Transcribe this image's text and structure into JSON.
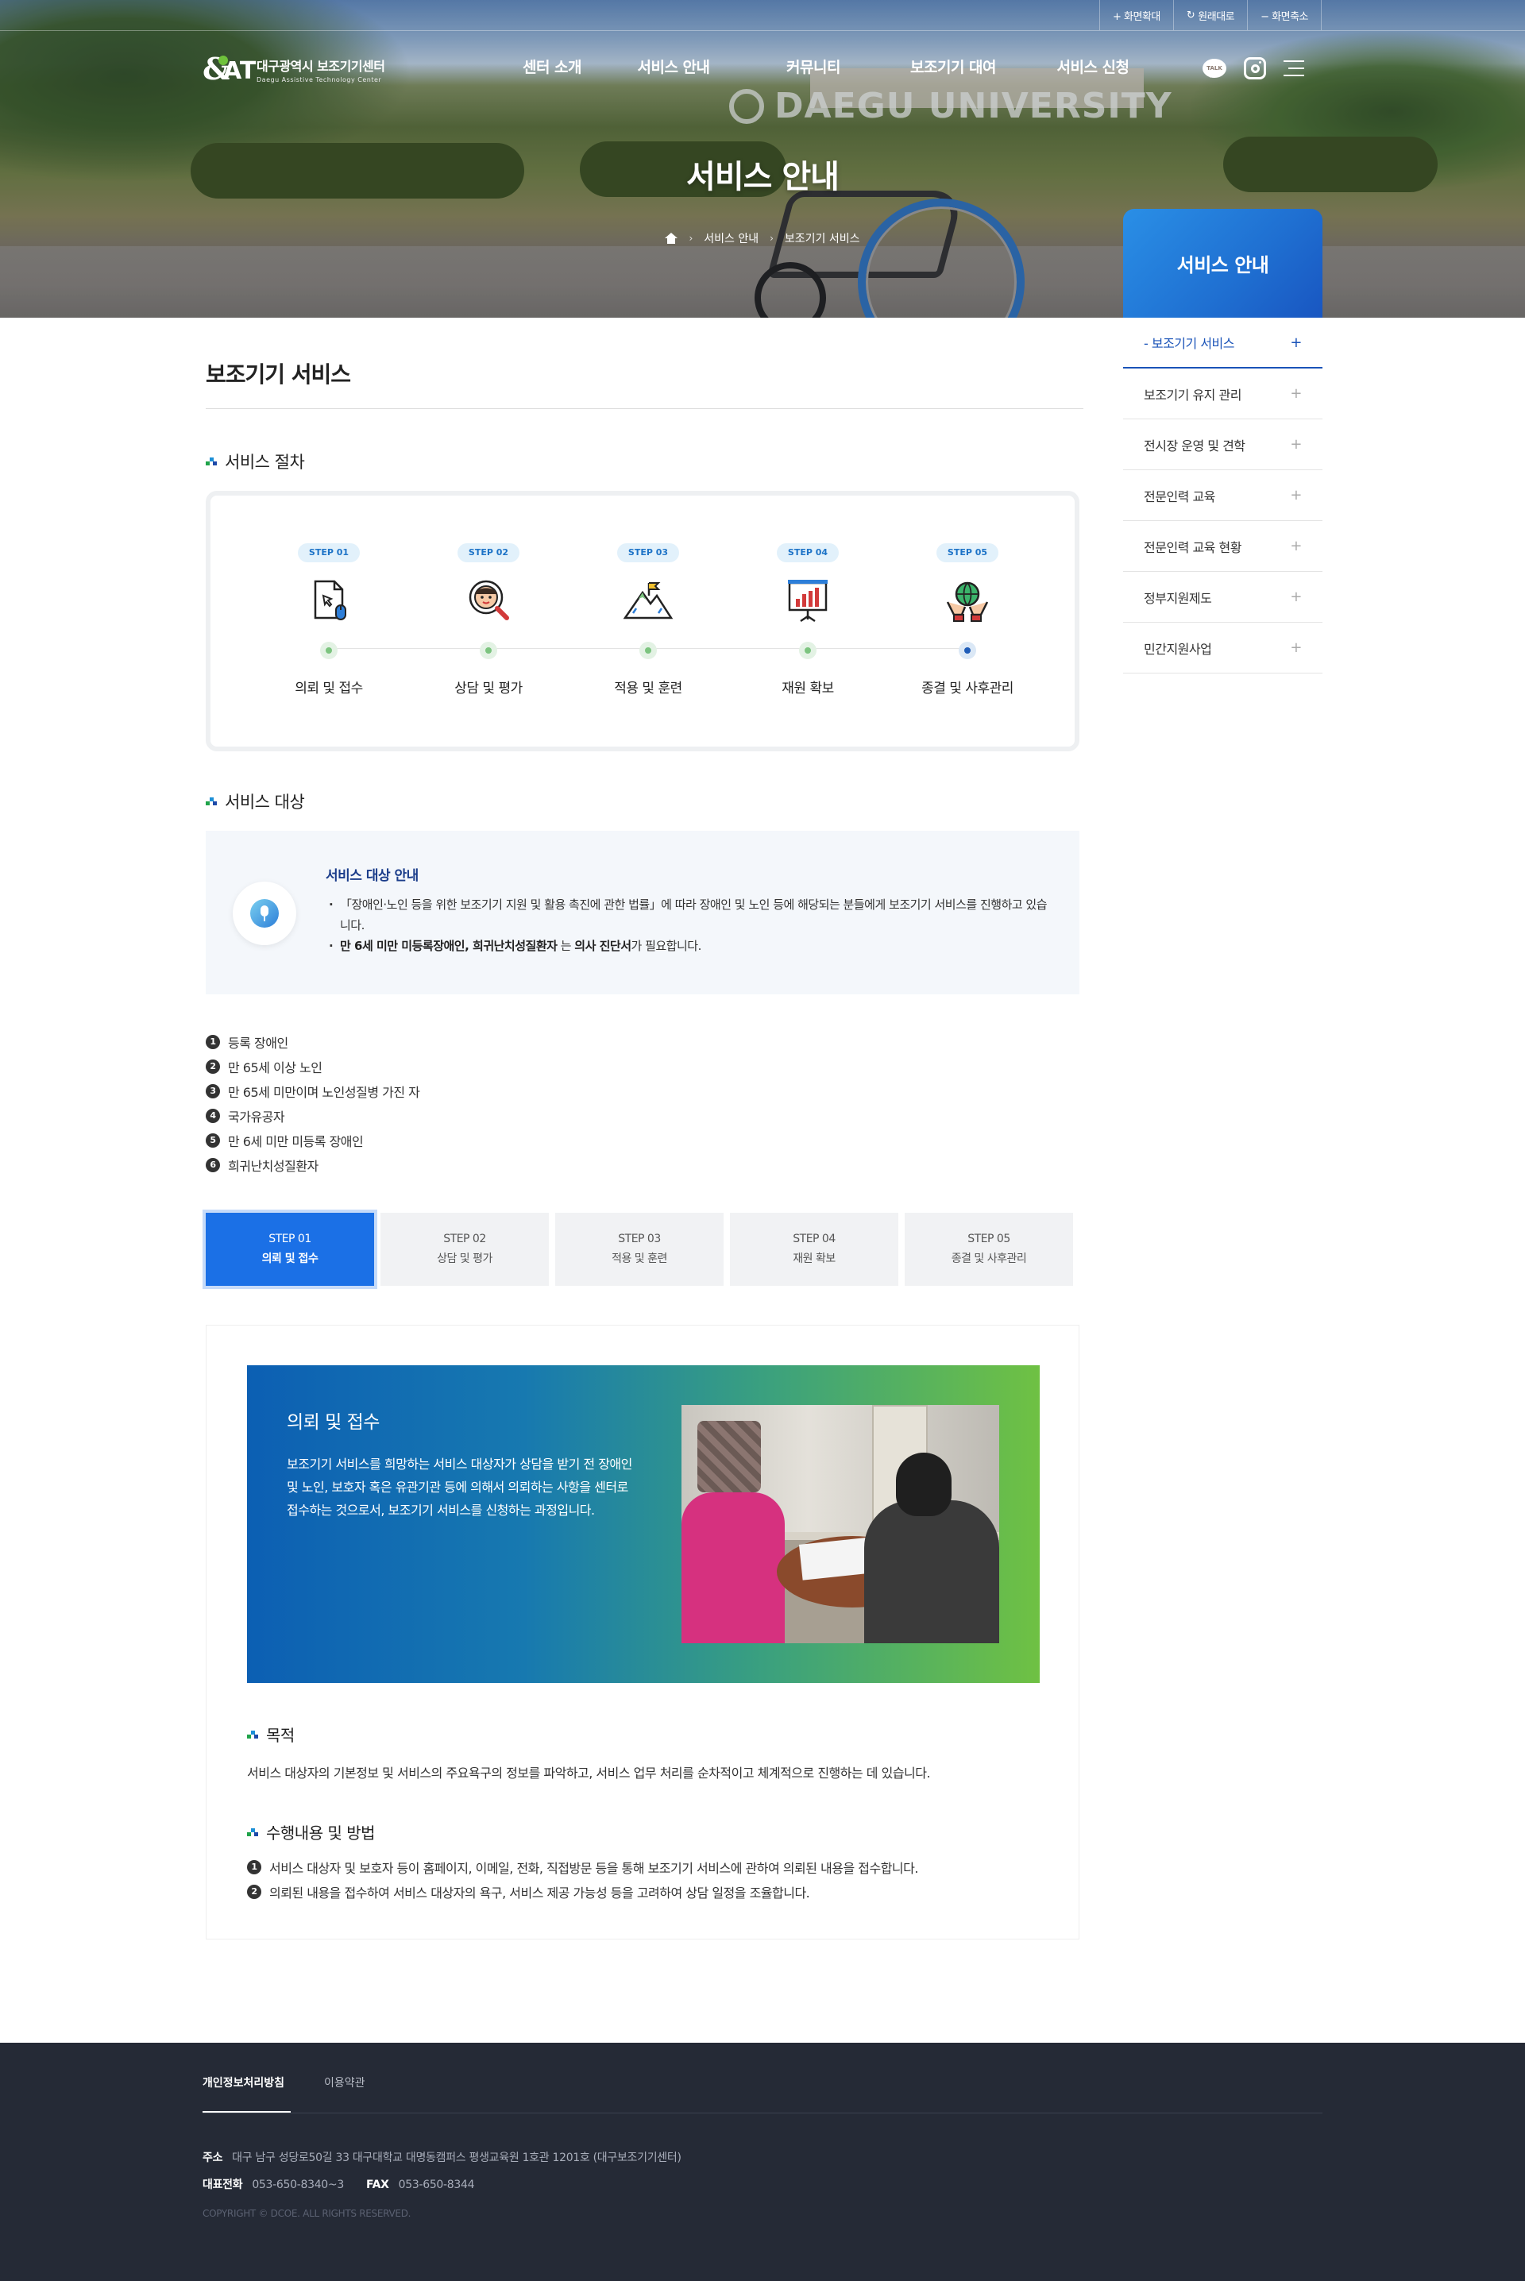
{
  "util": [
    "+ 화면확대",
    "원래대로",
    "− 화면축소"
  ],
  "logo": {
    "kr": "대구광역시 보조기기센터",
    "en": "Daegu Assistive Technology Center"
  },
  "gnb": [
    "센터 소개",
    "서비스 안내",
    "커뮤니티",
    "보조기기 대여",
    "서비스 신청"
  ],
  "header_icons": {
    "talk": "TALK"
  },
  "hero": {
    "sign": "DAEGU UNIVERSITY",
    "title": "서비스 안내",
    "crumb": [
      "서비스 안내",
      "보조기기 서비스"
    ]
  },
  "sidebar": {
    "title": "서비스 안내",
    "items": [
      {
        "label": "-  보조기기 서비스",
        "active": true
      },
      {
        "label": "보조기기 유지 관리"
      },
      {
        "label": "전시장 운영 및 견학"
      },
      {
        "label": "전문인력 교육"
      },
      {
        "label": "전문인력 교육 현황"
      },
      {
        "label": "정부지원제도"
      },
      {
        "label": "민간지원사업"
      }
    ],
    "plus": "+"
  },
  "page_title": "보조기기 서비스",
  "process": {
    "heading": "서비스 절차",
    "steps": [
      {
        "badge": "STEP 01",
        "label": "의뢰 및 접수",
        "icon": "document-mouse-icon"
      },
      {
        "badge": "STEP 02",
        "label": "상담 및 평가",
        "icon": "consult-magnifier-icon"
      },
      {
        "badge": "STEP 03",
        "label": "적용 및 훈련",
        "icon": "mountain-flag-icon"
      },
      {
        "badge": "STEP 04",
        "label": "재원 확보",
        "icon": "presentation-chart-icon"
      },
      {
        "badge": "STEP 05",
        "label": "종결 및 사후관리",
        "icon": "hands-globe-icon"
      }
    ]
  },
  "target": {
    "heading": "서비스 대상",
    "box_title": "서비스 대상 안내",
    "line1": "「장애인·노인 등을 위한 보조기기 지원 및 활용 촉진에 관한 법률」에 따라 장애인 및 노인 등에 해당되는 분들에게 보조기기 서비스를 진행하고 있습니다.",
    "line2_bold": "만 6세 미만 미등록장애인, 희귀난치성질환자",
    "line2_mid": " 는 ",
    "line2_bold2": "의사 진단서",
    "line2_end": "가 필요합니다.",
    "list": [
      "등록 장애인",
      "만 65세 이상 노인",
      "만 65세 미만이며 노인성질병 가진 자",
      "국가유공자",
      "만 6세 미만 미등록 장애인",
      "희귀난치성질환자"
    ]
  },
  "tabs": [
    {
      "step": "STEP 01",
      "label": "의뢰 및 접수",
      "active": true
    },
    {
      "step": "STEP 02",
      "label": "상담 및 평가"
    },
    {
      "step": "STEP 03",
      "label": "적용 및 훈련"
    },
    {
      "step": "STEP 04",
      "label": "재원 확보"
    },
    {
      "step": "STEP 05",
      "label": "종결 및 사후관리"
    }
  ],
  "detail": {
    "title": "의뢰 및 접수",
    "desc": "보조기기 서비스를 희망하는 서비스 대상자가 상담을 받기 전 장애인 및 노인, 보호자 혹은 유관기관 등에 의해서 의뢰하는 사항을 센터로 접수하는 것으로서, 보조기기 서비스를 신청하는 과정입니다.",
    "purpose_h": "목적",
    "purpose": "서비스 대상자의 기본정보 및 서비스의 주요욕구의 정보를 파악하고, 서비스 업무 처리를 순차적이고 체계적으로 진행하는 데 있습니다.",
    "method_h": "수행내용 및 방법",
    "methods": [
      "서비스 대상자 및 보호자 등이 홈페이지, 이메일, 전화, 직접방문 등을 통해 보조기기 서비스에 관하여 의뢰된 내용을 접수합니다.",
      "의뢰된 내용을 접수하여 서비스 대상자의 욕구, 서비스 제공 가능성 등을 고려하여 상담 일정을 조율합니다."
    ]
  },
  "footer": {
    "links": [
      "개인정보처리방침",
      "이용약관"
    ],
    "addr_label": "주소",
    "addr": "대구 남구 성당로50길 33 대구대학교 대명동캠퍼스 평생교육원 1호관 1201호 (대구보조기기센터)",
    "tel_label": "대표전화",
    "tel": "053-650-8340~3",
    "fax_label": "FAX",
    "fax": "053-650-8344",
    "copy": "COPYRIGHT © DCOE. ALL RIGHTS RESERVED."
  }
}
